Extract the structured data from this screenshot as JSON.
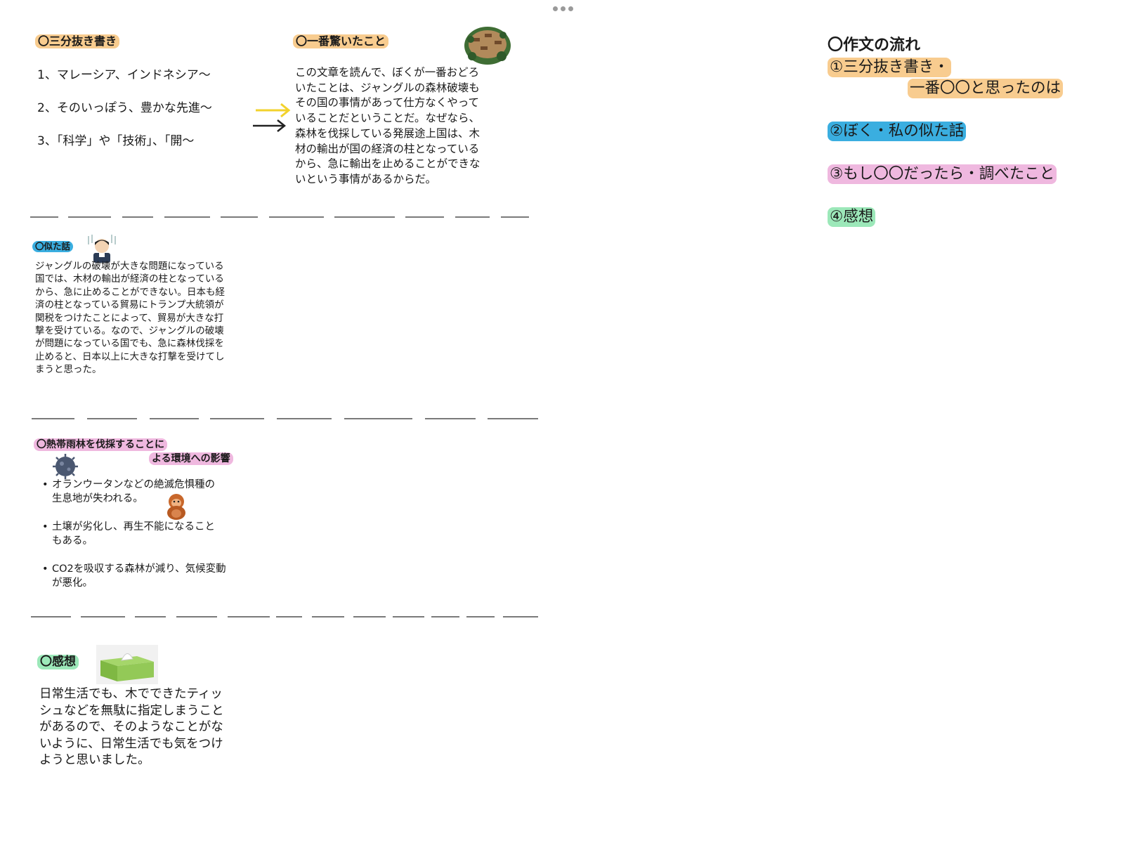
{
  "colors": {
    "orange_highlight": "#f8cc8f",
    "blue_highlight": "#3aaee0",
    "pink_highlight": "#efb8df",
    "green_highlight": "#9ce8b9",
    "yellow_arrow": "#f2d22c",
    "dash_line": "#7a7a7a"
  },
  "toolbar": {
    "more_icon": "more-dots-icon"
  },
  "summary": {
    "heading": "〇三分抜き書き",
    "items": [
      "1、マレーシア、インドネシア〜",
      "2、そのいっぽう、豊かな先進〜",
      "3、「科学」や「技術」、「開〜"
    ]
  },
  "surprise": {
    "heading": "〇一番驚いたこと",
    "icon": "deforestation-illustration",
    "lines": [
      "この文章を読んで、ぼくが一番おどろ",
      "いたことは、ジャングルの森林破壊も",
      "その国の事情があって仕方なくやって",
      "いることだということだ。なぜなら、",
      "森林を伐採している発展途上国は、木",
      "材の輸出が国の経済の柱となっている",
      "から、急に輸出を止めることができな",
      "いという事情があるからだ。"
    ]
  },
  "similar": {
    "heading": "〇似た話",
    "icon": "worried-man-illustration",
    "lines": [
      "ジャングルの破壊が大きな問題になっている",
      "国では、木材の輸出が経済の柱となっている",
      "から、急に止めることができない。日本も経",
      "済の柱となっている貿易にトランプ大統領が",
      "関税をつけたことによって、貿易が大きな打",
      "撃を受けている。なので、ジャングルの破壊",
      "が問題になっている国でも、急に森林伐採を",
      "止めると、日本以上に大きな打撃を受けてし",
      "まうと思った。"
    ]
  },
  "environment": {
    "heading_line1": "〇熱帯雨林を伐採することに",
    "heading_line2": "よる環境への影響",
    "icons": [
      "virus-illustration",
      "orangutan-illustration"
    ],
    "bullets": [
      {
        "line1": "オランウータンなどの絶滅危惧種の",
        "line2": "生息地が失われる。"
      },
      {
        "line1": "土壌が劣化し、再生不能になること",
        "line2": "もある。"
      },
      {
        "line1": "CO2を吸収する森林が減り、気候変動",
        "line2": "が悪化。"
      }
    ]
  },
  "impression": {
    "heading": "〇感想",
    "icon": "tissue-box-illustration",
    "lines": [
      "日常生活でも、木でできたティッ",
      "シュなどを無駄に指定しまうこと",
      "があるので、そのようなことがな",
      "いように、日常生活でも気をつけ",
      "ようと思いました。"
    ]
  },
  "flow": {
    "title": "〇作文の流れ",
    "item1_line1": "①三分抜き書き・",
    "item1_line2": "一番〇〇と思ったのは",
    "item2": "②ぼく・私の似た話",
    "item3": "③もし〇〇だったら・調べたこと",
    "item4": "④感想"
  }
}
